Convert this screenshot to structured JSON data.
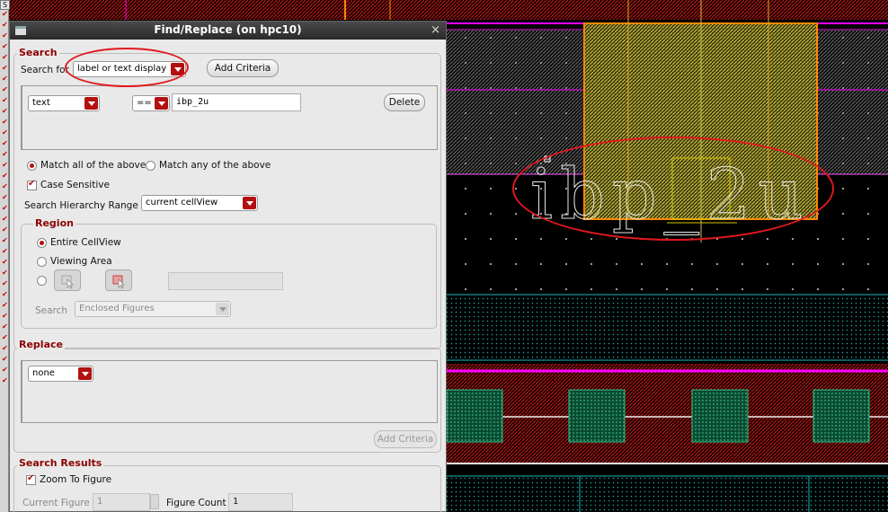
{
  "window": {
    "title": "Find/Replace (on hpc10)",
    "close_glyph": "×"
  },
  "parent": {
    "corner_label": "S"
  },
  "search": {
    "group_label": "Search",
    "search_for_label": "Search for",
    "search_for_value": "label or text display",
    "add_criteria_label": "Add Criteria",
    "criteria": {
      "property": "text",
      "operator": "==",
      "value": "ibp_2u",
      "delete_label": "Delete"
    },
    "match_all_label": "Match all of the above",
    "match_any_label": "Match any of the above",
    "match_all_selected": true,
    "case_sensitive_label": "Case Sensitive",
    "case_sensitive_checked": true,
    "hierarchy_label": "Search Hierarchy Range",
    "hierarchy_value": "current cellView"
  },
  "region": {
    "group_label": "Region",
    "entire_label": "Entire CellView",
    "viewing_label": "Viewing Area",
    "entire_selected": true,
    "search_label": "Search",
    "search_value": "Enclosed Figures"
  },
  "replace": {
    "group_label": "Replace",
    "value": "none",
    "add_criteria_label": "Add Criteria"
  },
  "results": {
    "group_label": "Search Results",
    "zoom_label": "Zoom To Figure",
    "zoom_checked": true,
    "current_figure_label": "Current Figure",
    "current_figure_value": "1",
    "figure_count_label": "Figure Count",
    "figure_count_value": "1"
  },
  "layout_view": {
    "label_text": "ibp_2u"
  },
  "colors": {
    "accent": "#b31010",
    "annotation": "#e0191e",
    "magenta": "#ff00ff",
    "orange": "#ff8800",
    "yellow": "#d4c800",
    "cyan": "#00c8c8",
    "green": "#1a9a5a"
  }
}
